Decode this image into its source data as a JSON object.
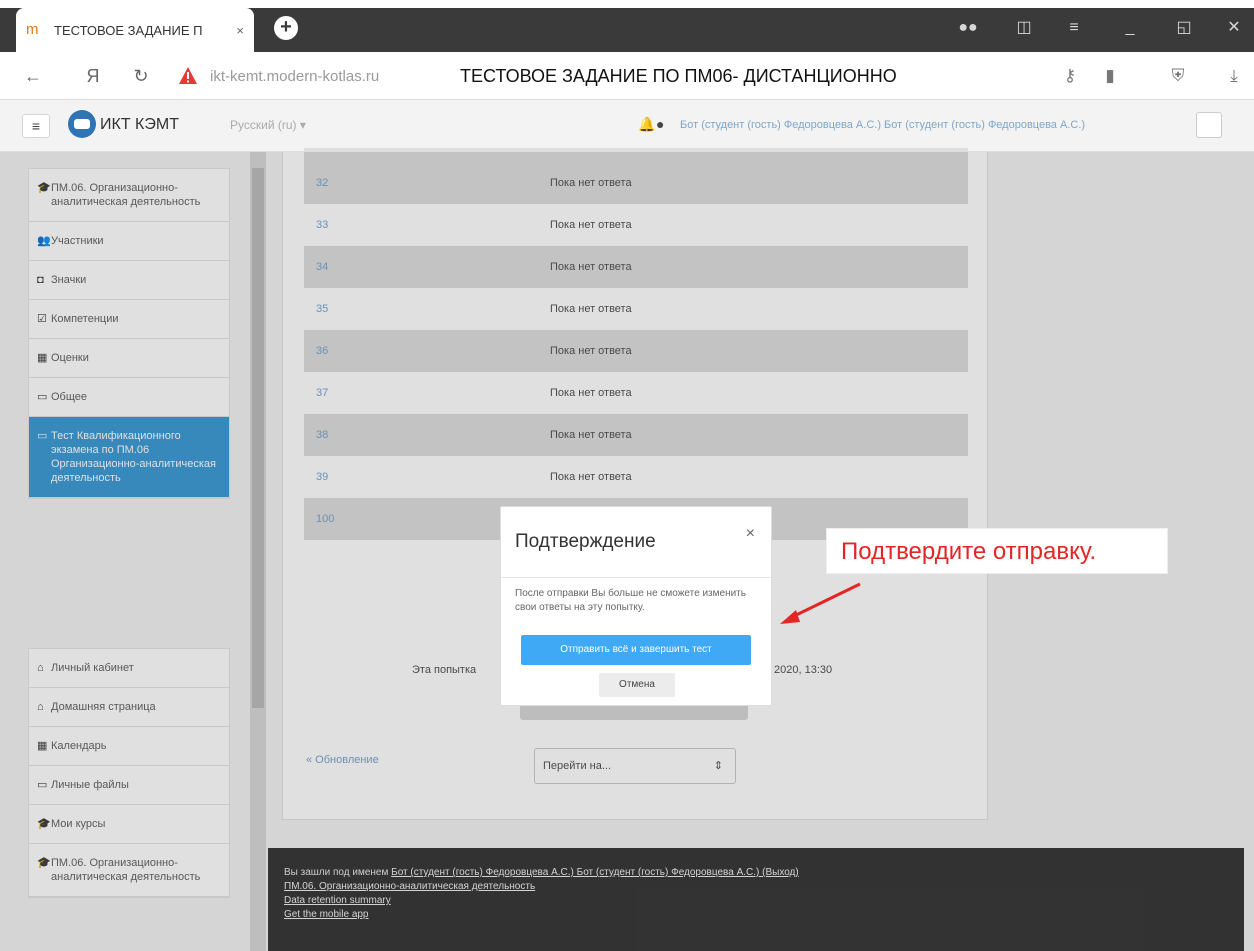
{
  "browser": {
    "tab_title": "ТЕСТОВОЕ ЗАДАНИЕ П",
    "tab_close": "×",
    "new_tab": "+",
    "url_host": "ikt-kemt.modern-kotlas.ru",
    "page_title": "ТЕСТОВОЕ ЗАДАНИЕ ПО ПМ06- ДИСТАНЦИОННО"
  },
  "navbar": {
    "site_name": "ИКТ КЭМТ",
    "language": "Русский (ru) ▾",
    "user_text": "Бот (студент (гость) Федоровцева А.С.) Бот (студент (гость) Федоровцева А.С.)"
  },
  "sidebar": {
    "items": [
      {
        "icon": "graduation-cap-icon",
        "glyph": "🎓",
        "label": "ПМ.06. Организационно-аналитическая деятельность"
      },
      {
        "icon": "users-icon",
        "glyph": "👥",
        "label": "Участники"
      },
      {
        "icon": "badge-icon",
        "glyph": "◘",
        "label": "Значки"
      },
      {
        "icon": "competencies-icon",
        "glyph": "☑",
        "label": "Компетенции"
      },
      {
        "icon": "grades-icon",
        "glyph": "▦",
        "label": "Оценки"
      },
      {
        "icon": "folder-icon",
        "glyph": "▭",
        "label": "Общее"
      },
      {
        "icon": "folder-icon",
        "glyph": "▭",
        "label": "Тест Квалификационного экзамена по ПМ.06 Организационно-аналитическая деятельность",
        "active": true
      }
    ],
    "items2": [
      {
        "icon": "dashboard-icon",
        "glyph": "⌂",
        "label": "Личный кабинет"
      },
      {
        "icon": "home-icon",
        "glyph": "⌂",
        "label": "Домашняя страница"
      },
      {
        "icon": "calendar-icon",
        "glyph": "▦",
        "label": "Календарь"
      },
      {
        "icon": "file-icon",
        "glyph": "▭",
        "label": "Личные файлы"
      },
      {
        "icon": "graduation-cap-icon",
        "glyph": "🎓",
        "label": "Мои курсы"
      },
      {
        "icon": "graduation-cap-icon",
        "glyph": "🎓",
        "label": "ПМ.06. Организационно-аналитическая деятельность"
      }
    ]
  },
  "questions": [
    {
      "num": "32",
      "status": "Пока нет ответа"
    },
    {
      "num": "33",
      "status": "Пока нет ответа"
    },
    {
      "num": "34",
      "status": "Пока нет ответа"
    },
    {
      "num": "35",
      "status": "Пока нет ответа"
    },
    {
      "num": "36",
      "status": "Пока нет ответа"
    },
    {
      "num": "37",
      "status": "Пока нет ответа"
    },
    {
      "num": "38",
      "status": "Пока нет ответа"
    },
    {
      "num": "39",
      "status": "Пока нет ответа"
    },
    {
      "num": "100",
      "status": ""
    }
  ],
  "main": {
    "attempt_text": "Эта попытка",
    "attempt_date": "2020, 13:30",
    "back_link": "« Обновление",
    "jump_placeholder": "Перейти на...",
    "jump_arrow": "⇕"
  },
  "footer": {
    "line1_prefix": "Вы зашли под именем",
    "line1_link": "Бот (студент (гость) Федоровцева А.С.) Бот (студент (гость) Федоровцева А.С.) (Выход)",
    "line2": "ПМ.06. Организационно-аналитическая деятельность",
    "line3": "Data retention summary",
    "line4": "Get the mobile app"
  },
  "modal": {
    "title": "Подтверждение",
    "close": "×",
    "body": "После отправки Вы больше не сможете изменить свои ответы на эту попытку.",
    "confirm": "Отправить всё и завершить тест",
    "cancel": "Отмена"
  },
  "annotation": {
    "text": "Подтвердите отправку."
  },
  "colors": {
    "accent": "#3fa9f5",
    "active_sidebar": "#3f9cd6",
    "annotation_red": "#e52424"
  }
}
